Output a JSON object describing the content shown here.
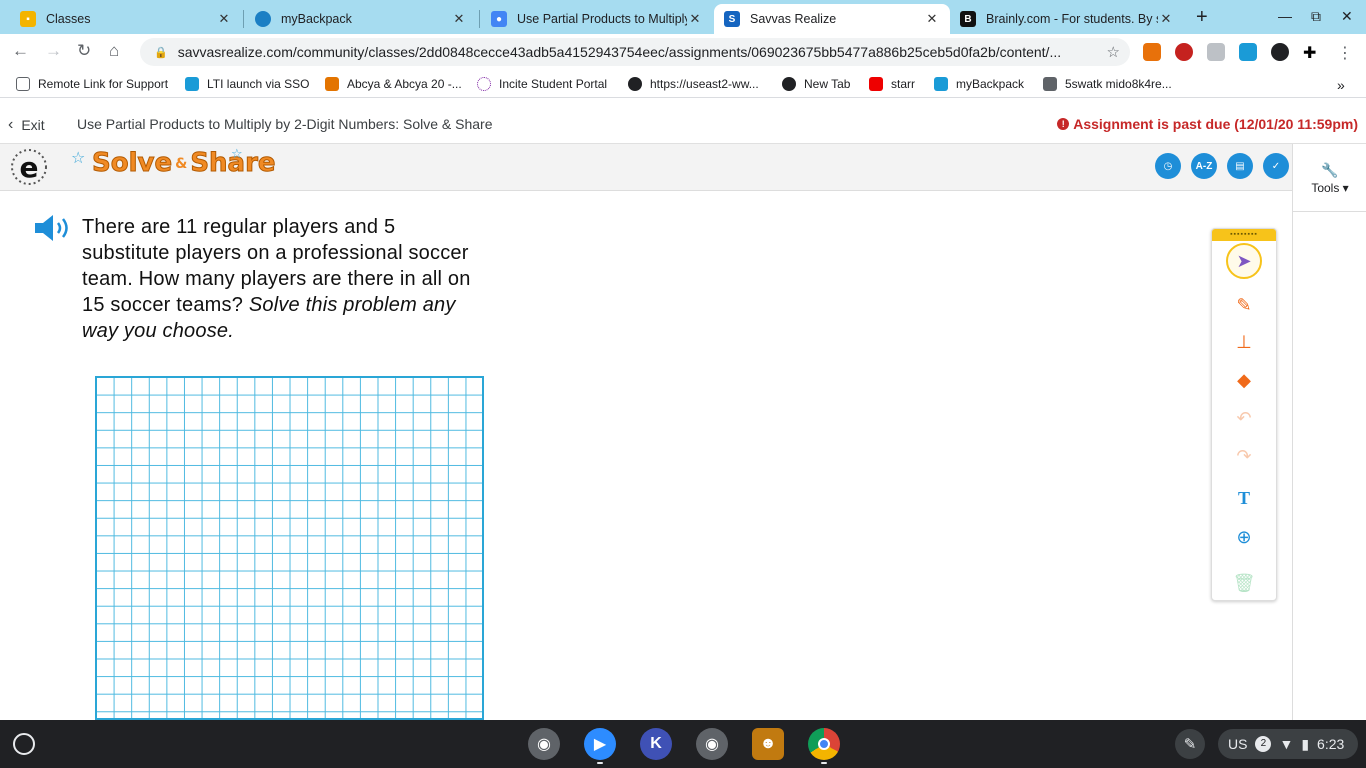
{
  "browser": {
    "tabs": [
      {
        "label": "Classes",
        "close": "✕"
      },
      {
        "label": "myBackpack",
        "close": "✕"
      },
      {
        "label": "Use Partial Products to Multiply",
        "close": "✕"
      },
      {
        "label": "Savvas Realize",
        "close": "✕"
      },
      {
        "label": "Brainly.com - For students. By st",
        "close": "✕"
      }
    ],
    "active_tab": 3,
    "url": "savvasrealize.com/community/classes/2dd0848cecce43adb5a4152943754eec/assignments/069023675bb5477a886b25ceb5d0fa2b/content/...",
    "bookmarks": [
      "Remote Link for Support",
      "LTI launch via SSO",
      "Abcya & Abcya 20 -...",
      "Incite Student Portal",
      "https://useast2-ww...",
      "New Tab",
      "starr",
      "myBackpack",
      "5swatk mido8k4re..."
    ],
    "bookmarks_overflow": "»"
  },
  "assignment": {
    "exit_label": "Exit",
    "title": "Use Partial Products to Multiply by 2-Digit Numbers: Solve & Share",
    "past_due": "Assignment is past due (12/01/20 11:59pm)"
  },
  "solve_share": {
    "word1": "Solve",
    "amp": "&",
    "word2": "Share",
    "tool_az": "A-Z"
  },
  "tools": {
    "label": "Tools ▾"
  },
  "problem": {
    "text": "There are 11 regular players and 5 substitute players on a professional soccer team. How many players are there in all on 15 soccer teams?",
    "instruction": "Solve this problem any way you choose."
  },
  "shelf": {
    "locale": "US",
    "notifications": "2",
    "time": "6:23"
  },
  "colors": {
    "accent": "#1e8ed8",
    "grid": "#2aa6d6",
    "palette_handle": "#f7c31a",
    "past_due": "#c62828",
    "tab_strip": "#a6dcf0"
  }
}
